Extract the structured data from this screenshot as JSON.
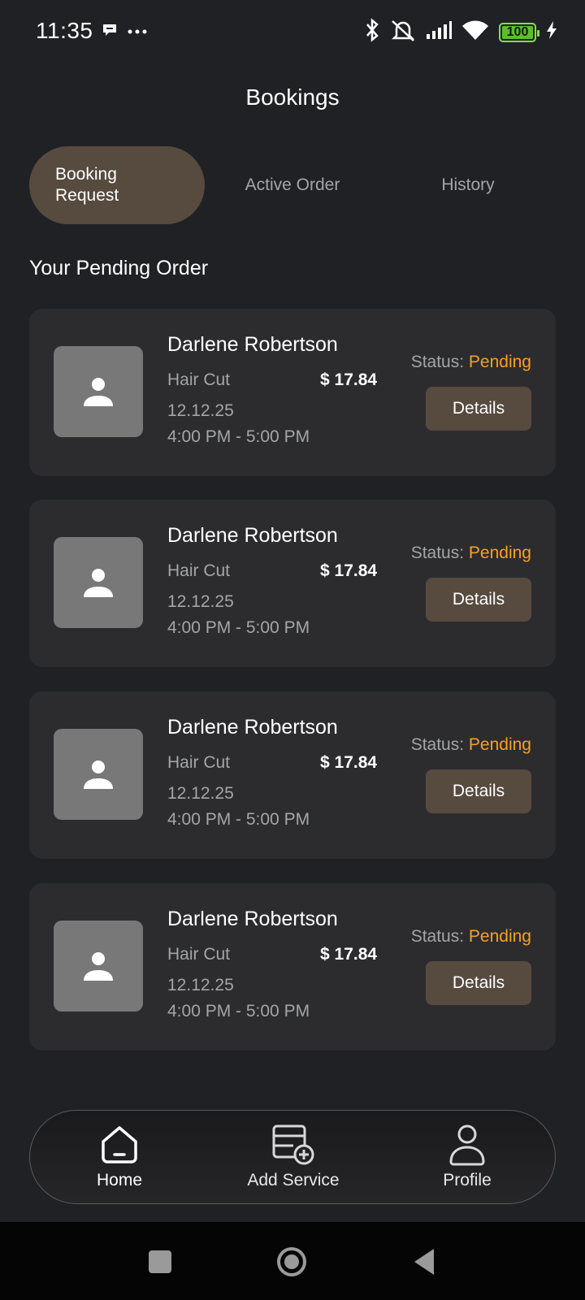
{
  "status_bar": {
    "time": "11:35",
    "battery": "100",
    "icons": [
      "chat-bubble-icon",
      "more-dots-icon",
      "bluetooth-icon",
      "alarm-off-icon",
      "signal-icon",
      "wifi-icon",
      "battery-icon",
      "charging-bolt-icon"
    ]
  },
  "header": {
    "title": "Bookings"
  },
  "tabs": [
    {
      "label": "Booking Request",
      "active": true
    },
    {
      "label": "Active Order",
      "active": false
    },
    {
      "label": "History",
      "active": false
    }
  ],
  "section": {
    "title": "Your Pending Order"
  },
  "orders": [
    {
      "name": "Darlene Robertson",
      "service": "Hair Cut",
      "price": "$ 17.84",
      "date": "12.12.25",
      "time": "4:00 PM - 5:00 PM",
      "status_label": "Status:",
      "status_value": "Pending",
      "action": "Details"
    },
    {
      "name": "Darlene Robertson",
      "service": "Hair Cut",
      "price": "$ 17.84",
      "date": "12.12.25",
      "time": "4:00 PM - 5:00 PM",
      "status_label": "Status:",
      "status_value": "Pending",
      "action": "Details"
    },
    {
      "name": "Darlene Robertson",
      "service": "Hair Cut",
      "price": "$ 17.84",
      "date": "12.12.25",
      "time": "4:00 PM - 5:00 PM",
      "status_label": "Status:",
      "status_value": "Pending",
      "action": "Details"
    },
    {
      "name": "Darlene Robertson",
      "service": "Hair Cut",
      "price": "$ 17.84",
      "date": "12.12.25",
      "time": "4:00 PM - 5:00 PM",
      "status_label": "Status:",
      "status_value": "Pending",
      "action": "Details"
    }
  ],
  "bottom_nav": [
    {
      "label": "Home",
      "icon": "home-icon",
      "active": true
    },
    {
      "label": "Add Service",
      "icon": "add-service-icon",
      "active": false
    },
    {
      "label": "Profile",
      "icon": "profile-icon",
      "active": false
    }
  ],
  "colors": {
    "background": "#202125",
    "card": "#2c2c2f",
    "accent_brown": "#574a3e",
    "pending": "#f6a022",
    "battery": "#5cbf2a"
  }
}
